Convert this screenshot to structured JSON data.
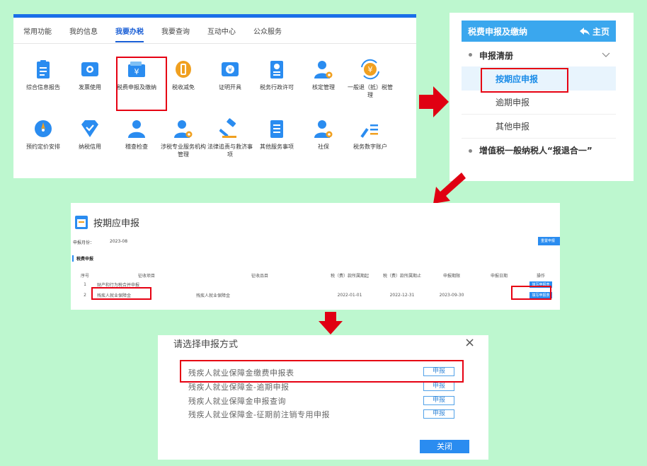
{
  "colors": {
    "background": "#bdf7cf",
    "primary": "#1a6fe8",
    "highlight": "#e60012",
    "arrow": "#e00012"
  },
  "portal": {
    "tabs": [
      "常用功能",
      "我的信息",
      "我要办税",
      "我要查询",
      "互动中心",
      "公众服务"
    ],
    "active_tab": "我要办税",
    "tiles": [
      {
        "label": "综合信息报告",
        "icon": "clipboard-icon",
        "color": "#2a8cf0"
      },
      {
        "label": "发票使用",
        "icon": "ticket-icon",
        "color": "#2a8cf0"
      },
      {
        "label": "税费申报及缴纳",
        "icon": "yuan-wallet-icon",
        "color": "#2a8cf0"
      },
      {
        "label": "税收减免",
        "icon": "coin-icon",
        "color": "#f0a020"
      },
      {
        "label": "证明开具",
        "icon": "yuan-certificate-icon",
        "color": "#2a8cf0"
      },
      {
        "label": "税务行政许可",
        "icon": "id-badge-icon",
        "color": "#2a8cf0"
      },
      {
        "label": "核定管理",
        "icon": "person-gear-icon",
        "color": "#2a8cf0"
      },
      {
        "label": "一般退（抵）税管理",
        "icon": "yuan-refresh-icon",
        "color": "#f0a020"
      },
      {
        "label": "预约定价安排",
        "icon": "compass-icon",
        "color": "#2a8cf0"
      },
      {
        "label": "纳税信用",
        "icon": "diamond-check-icon",
        "color": "#2a8cf0"
      },
      {
        "label": "稽查检查",
        "icon": "person-icon",
        "color": "#2a8cf0"
      },
      {
        "label": "涉税专业服务机构管理",
        "icon": "person-gear-icon",
        "color": "#2a8cf0"
      },
      {
        "label": "法律追责与救济事项",
        "icon": "gavel-icon",
        "color": "#2a8cf0"
      },
      {
        "label": "其他服务事项",
        "icon": "document-list-icon",
        "color": "#2a8cf0"
      },
      {
        "label": "社保",
        "icon": "person-gear-icon",
        "color": "#2a8cf0"
      },
      {
        "label": "税务数字账户",
        "icon": "pen-list-icon",
        "color": "#2a8cf0"
      }
    ]
  },
  "sidebar": {
    "title": "税费申报及缴纳",
    "home": "主页",
    "group1": "申报清册",
    "items": [
      "按期应申报",
      "逾期申报",
      "其他申报"
    ],
    "group2": "增值税一般纳税人“报退合一”"
  },
  "declaration": {
    "title": "按期应申报",
    "month_label": "申报月份：",
    "month_value": "2023-08",
    "reset_button": "重置申报",
    "section": "税费申报",
    "headers": [
      "序号",
      "征收项目",
      "征收品目",
      "税（费）款所属期起",
      "税（费）款所属期止",
      "申报期限",
      "申报日期",
      "操作"
    ],
    "rows": [
      [
        "1",
        "财产和行为税合并申报",
        "",
        "",
        "",
        "",
        "",
        ""
      ],
      [
        "2",
        "残疾人就业保障金",
        "残疾人就业保障金",
        "2022-01-01",
        "2022-12-31",
        "2023-09-30",
        "",
        ""
      ]
    ],
    "fill_button": "填写申报表"
  },
  "modal": {
    "title": "请选择申报方式",
    "close": "×",
    "options": [
      "残疾人就业保障金缴费申报表",
      "残疾人就业保障金-逾期申报",
      "残疾人就业保障金申报查询",
      "残疾人就业保障金-征期前注销专用申报"
    ],
    "option_button": "申报",
    "close_button": "关闭"
  }
}
